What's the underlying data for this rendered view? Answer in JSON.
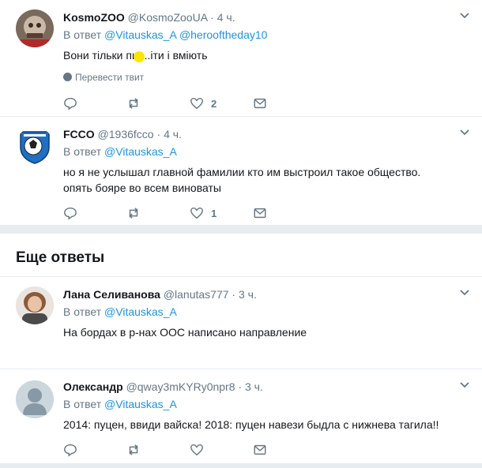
{
  "tweets": [
    {
      "name": "KosmoZOO",
      "handle": "@KosmoZooUA",
      "dot": "·",
      "time": "4 ч.",
      "reply_prefix": "В ответ",
      "reply_to": [
        "@Vitauskas_A",
        "@herooftheday10"
      ],
      "text": "Вони тільки пи ...іти і вміють",
      "translate": "Перевести твит",
      "likes": "2"
    },
    {
      "name": "FCCO",
      "handle": "@1936fcco",
      "dot": "·",
      "time": "4 ч.",
      "reply_prefix": "В ответ",
      "reply_to": [
        "@Vitauskas_A"
      ],
      "text": "но я не услышал главной фамилии кто им выстроил такое общество. опять бояре во всем виноваты",
      "likes": "1"
    },
    {
      "name": "Лана Селиванова",
      "handle": "@lanutas777",
      "dot": "·",
      "time": "3 ч.",
      "reply_prefix": "В ответ",
      "reply_to": [
        "@Vitauskas_A"
      ],
      "text": "На бордах в р-нах ООС написано направление"
    },
    {
      "name": "Олександр",
      "handle": "@qway3mKYRy0npr8",
      "dot": "·",
      "time": "3 ч.",
      "reply_prefix": "В ответ",
      "reply_to": [
        "@Vitauskas_A"
      ],
      "text": "2014: пуцен, ввиди вайска! 2018: пуцен навези быдла с нижнева тагила!!"
    }
  ],
  "section_title": "Еще ответы",
  "colors": {
    "link": "#1b95e0",
    "muted": "#657786",
    "divider": "#e6ecf0"
  }
}
